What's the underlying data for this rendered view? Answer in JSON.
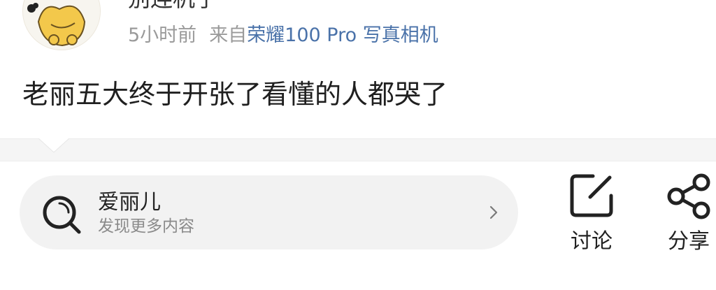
{
  "post": {
    "author": "别连机子",
    "time": "5小时前",
    "source_prefix": "来自",
    "source_device": "荣耀100 Pro 写真相机",
    "text": "老丽五大终于开张了看懂的人都哭了"
  },
  "search": {
    "title": "爱丽儿",
    "subtitle": "发现更多内容"
  },
  "actions": {
    "discuss_label": "讨论",
    "share_label": "分享"
  },
  "colors": {
    "link": "#4a72a9",
    "meta": "#9a9a9a",
    "pill": "#f2f2f2"
  },
  "icons": [
    "avatar-illustration",
    "search-icon",
    "chevron-right-icon",
    "edit-icon",
    "share-icon"
  ]
}
